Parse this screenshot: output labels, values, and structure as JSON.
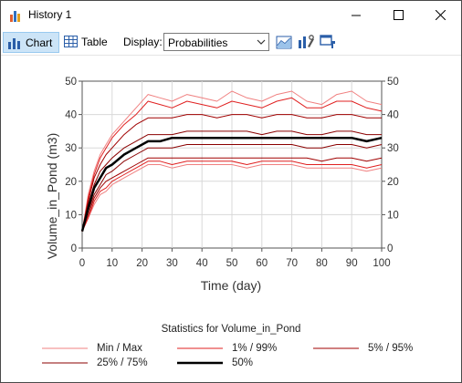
{
  "window": {
    "title": "History 1"
  },
  "toolbar": {
    "chart_label": "Chart",
    "table_label": "Table",
    "display_label": "Display:",
    "display_value": "Probabilities"
  },
  "colors": {
    "minmax": "#f08080",
    "p1_99": "#e02020",
    "p5_95": "#a00000",
    "p25_75": "#8b0000",
    "p50": "#000000"
  },
  "chart_data": {
    "type": "line",
    "xlabel": "Time (day)",
    "ylabel": "Volume_in_Pond (m3)",
    "xlim": [
      0,
      100
    ],
    "ylim": [
      0,
      50
    ],
    "x_ticks": [
      "0",
      "10",
      "20",
      "30",
      "40",
      "50",
      "60",
      "70",
      "80",
      "90",
      "100"
    ],
    "y_ticks": [
      "0",
      "10",
      "20",
      "30",
      "40",
      "50"
    ],
    "legend_title": "Statistics for Volume_in_Pond",
    "grid": true,
    "legend_placement": "bottom",
    "legend": [
      "Min / Max",
      "1% / 99%",
      "5% / 95%",
      "25% / 75%",
      "50%"
    ],
    "x": [
      0,
      2,
      4,
      6,
      8,
      10,
      14,
      18,
      22,
      26,
      30,
      35,
      40,
      45,
      50,
      55,
      60,
      65,
      70,
      75,
      80,
      85,
      90,
      95,
      100
    ],
    "series": [
      {
        "name": "Max",
        "values": [
          5,
          16,
          23,
          28,
          31,
          34,
          38,
          42,
          46,
          45,
          44,
          46,
          45,
          44,
          47,
          45,
          44,
          46,
          47,
          44,
          43,
          46,
          47,
          44,
          43
        ]
      },
      {
        "name": "99%",
        "values": [
          5,
          15,
          22,
          27,
          30,
          33,
          37,
          40,
          44,
          43,
          42,
          44,
          43,
          42,
          44,
          43,
          42,
          44,
          45,
          42,
          42,
          44,
          44,
          42,
          41
        ]
      },
      {
        "name": "95%",
        "values": [
          5,
          14,
          21,
          25,
          28,
          30,
          34,
          37,
          39,
          39,
          39,
          40,
          40,
          39,
          40,
          40,
          39,
          40,
          40,
          39,
          39,
          40,
          40,
          39,
          39
        ]
      },
      {
        "name": "75%",
        "values": [
          5,
          13,
          19,
          23,
          25,
          27,
          30,
          32,
          34,
          34,
          34,
          35,
          35,
          35,
          35,
          35,
          34,
          35,
          35,
          34,
          34,
          35,
          35,
          34,
          34
        ]
      },
      {
        "name": "50%",
        "values": [
          5,
          12,
          18,
          21,
          24,
          25,
          28,
          30,
          32,
          32,
          33,
          33,
          33,
          33,
          33,
          33,
          33,
          33,
          33,
          33,
          33,
          33,
          33,
          32,
          33
        ]
      },
      {
        "name": "25%",
        "values": [
          5,
          11,
          16,
          19,
          22,
          23,
          26,
          28,
          30,
          30,
          30,
          31,
          31,
          31,
          31,
          31,
          31,
          31,
          31,
          30,
          30,
          31,
          31,
          30,
          31
        ]
      },
      {
        "name": "5%",
        "values": [
          5,
          10,
          15,
          18,
          20,
          21,
          23,
          25,
          27,
          27,
          27,
          27,
          27,
          27,
          27,
          27,
          27,
          27,
          27,
          27,
          26,
          27,
          27,
          26,
          27
        ]
      },
      {
        "name": "1%",
        "values": [
          5,
          9,
          14,
          17,
          18,
          20,
          22,
          24,
          26,
          26,
          25,
          26,
          26,
          26,
          26,
          25,
          26,
          26,
          26,
          25,
          25,
          25,
          25,
          24,
          25
        ]
      },
      {
        "name": "Min",
        "values": [
          5,
          9,
          13,
          16,
          17,
          19,
          21,
          23,
          25,
          25,
          24,
          25,
          25,
          25,
          25,
          24,
          25,
          25,
          25,
          24,
          24,
          24,
          24,
          23,
          24
        ]
      }
    ]
  }
}
